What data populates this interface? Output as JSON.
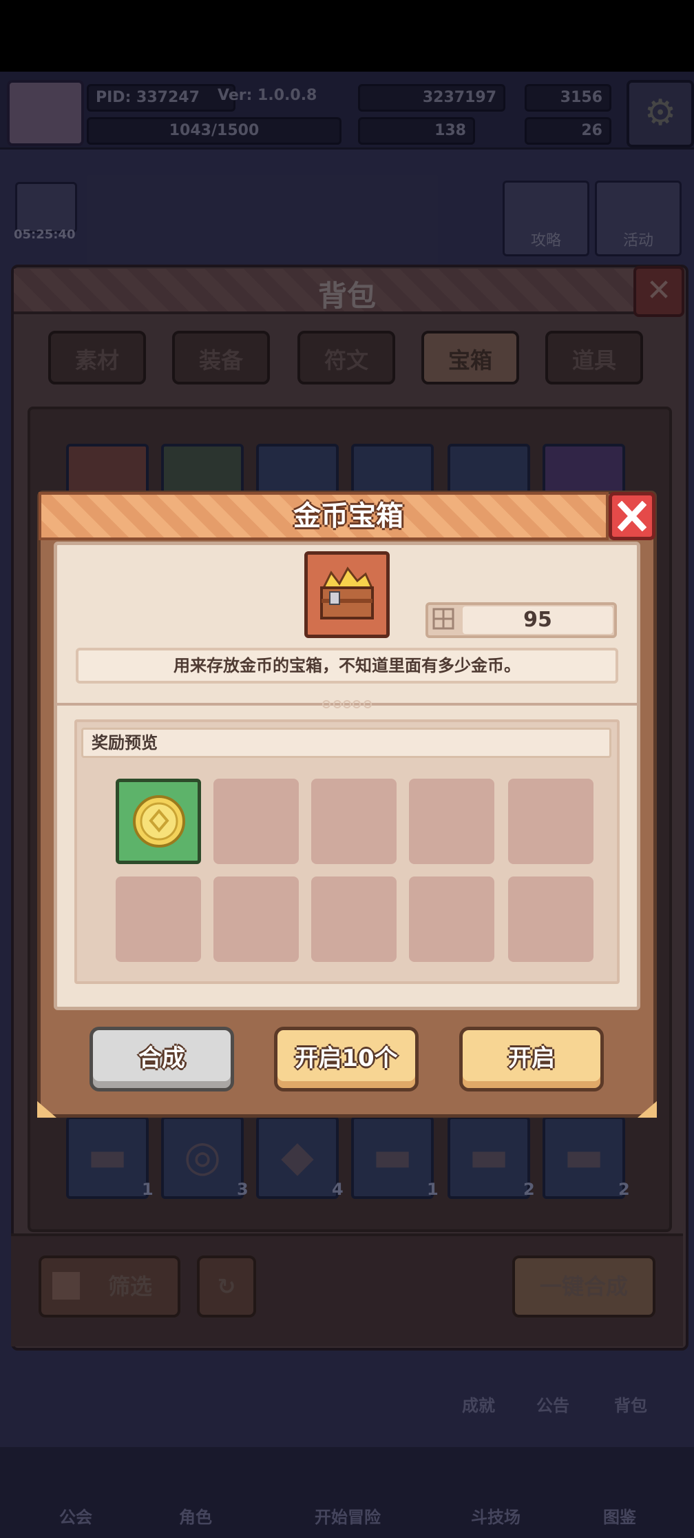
{
  "hud": {
    "pid": "PID: 337247",
    "version": "Ver: 1.0.0.8",
    "gold": "3237197",
    "gems": "3156",
    "exp": "1043/1500",
    "stat_b": "138",
    "stat_c": "26",
    "timer": "05:25:40",
    "guide_label": "攻略",
    "event_label": "活动"
  },
  "bag": {
    "title": "背包",
    "tabs": [
      "素材",
      "装备",
      "符文",
      "宝箱",
      "道具"
    ],
    "active_tab": "宝箱",
    "slot_counts": [
      "1",
      "3",
      "4",
      "1",
      "2",
      "2"
    ],
    "filter_label": "筛选",
    "combine_all_label": "一键合成"
  },
  "side_nav": {
    "achievements": "成就",
    "notice": "公告",
    "bag": "背包"
  },
  "bottom_nav": [
    "公会",
    "角色",
    "开始冒险",
    "斗技场",
    "图鉴"
  ],
  "dialog": {
    "title": "金币宝箱",
    "item_icon": "gold-chest-icon",
    "owned_count": "95",
    "description": "用来存放金币的宝箱，不知道里面有多少金币。",
    "reward_header": "奖励预览",
    "rewards": [
      {
        "icon": "gold-coin-icon"
      }
    ],
    "buttons": {
      "combine": "合成",
      "open_ten": "开启10个",
      "open": "开启"
    }
  },
  "colors": {
    "dialog_frame": "#9c6b4e",
    "header_orange": "#e59d6a",
    "close_red": "#e54a49",
    "button_yellow": "#f7d593",
    "button_gray": "#d9d9d9",
    "reward_green": "#5db36a"
  }
}
